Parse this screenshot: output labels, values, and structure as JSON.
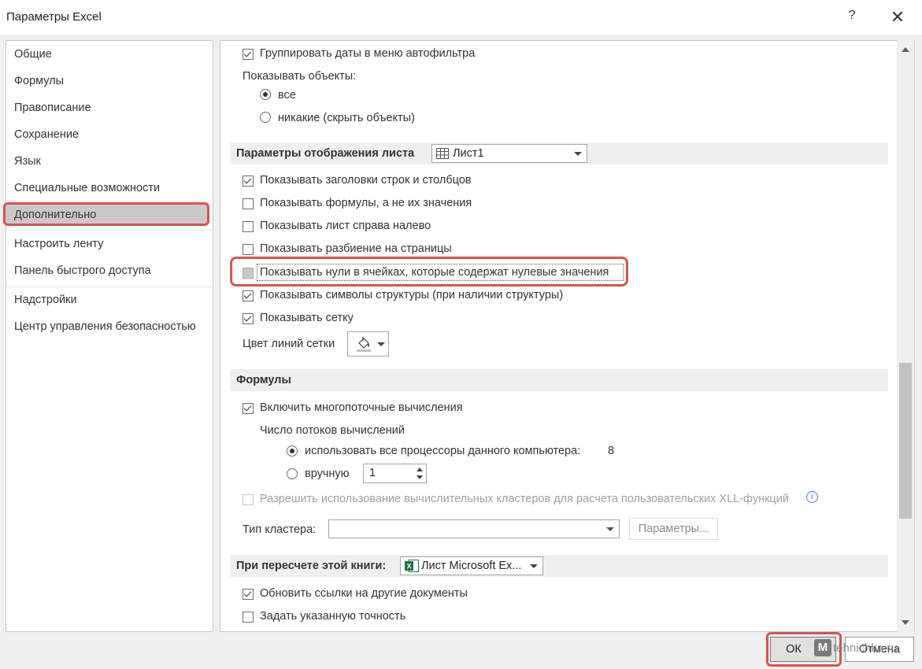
{
  "window": {
    "title": "Параметры Excel",
    "help": "?",
    "close": "✕"
  },
  "sidebar": {
    "items": [
      "Общие",
      "Формулы",
      "Правописание",
      "Сохранение",
      "Язык",
      "Специальные возможности",
      "Дополнительно",
      "Настроить ленту",
      "Панель быстрого доступа",
      "Надстройки",
      "Центр управления безопасностью"
    ],
    "selected": "Дополнительно"
  },
  "content": {
    "group_dates": {
      "label": "Группировать даты в меню автофильтра",
      "checked": true
    },
    "show_objects": {
      "label": "Показывать объекты:",
      "opt_all": "все",
      "opt_none": "никакие (скрыть объекты)",
      "selected": "все"
    },
    "sheet_section": {
      "title": "Параметры отображения листа",
      "sheet": "Лист1"
    },
    "sheet_options": [
      {
        "label": "Показывать заголовки строк и столбцов",
        "checked": true
      },
      {
        "label": "Показывать формулы, а не их значения",
        "checked": false
      },
      {
        "label": "Показывать лист справа налево",
        "checked": false
      },
      {
        "label": "Показывать разбиение на страницы",
        "checked": false
      },
      {
        "label": "Показывать нули в ячейках, которые содержат нулевые значения",
        "checked": false
      },
      {
        "label": "Показывать символы структуры (при наличии структуры)",
        "checked": true
      },
      {
        "label": "Показывать сетку",
        "checked": true
      }
    ],
    "grid_color_label": "Цвет линий сетки",
    "formulas_section": {
      "title": "Формулы"
    },
    "multithread": {
      "label": "Включить многопоточные вычисления",
      "checked": true
    },
    "threads_label": "Число потоков вычислений",
    "threads_all": {
      "label": "использовать все процессоры данного компьютера:",
      "value": "8"
    },
    "threads_manual": {
      "label": "вручную",
      "value": "1"
    },
    "cluster_allow": {
      "label": "Разрешить использование вычислительных кластеров для расчета пользовательских XLL-функций"
    },
    "cluster_type_label": "Тип кластера:",
    "cluster_params_button": "Параметры...",
    "recalc_section": {
      "title": "При пересчете этой книги:",
      "book": "Лист Microsoft Ex..."
    },
    "update_links": {
      "label": "Обновить ссылки на другие документы",
      "checked": true
    },
    "set_precision": {
      "label": "Задать указанную точность",
      "checked": false
    }
  },
  "footer": {
    "ok": "ОК",
    "cancel": "Отмена",
    "watermark": "tehnichka.ru"
  }
}
